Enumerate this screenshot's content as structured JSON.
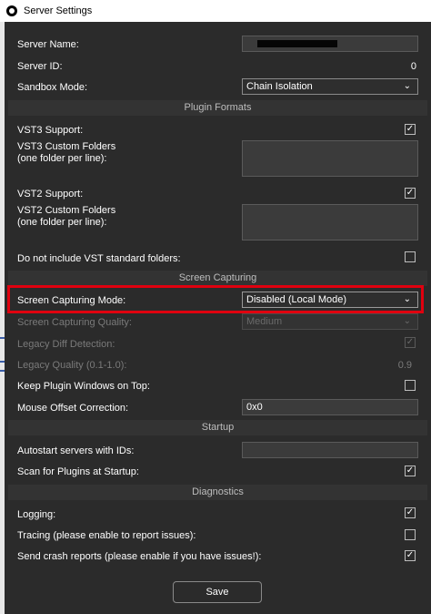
{
  "window": {
    "title": "Server Settings"
  },
  "fields": {
    "server_name": {
      "label": "Server Name:",
      "value": ""
    },
    "server_id": {
      "label": "Server ID:",
      "value": "0"
    },
    "sandbox_mode": {
      "label": "Sandbox Mode:",
      "value": "Chain Isolation"
    },
    "vst3_support": {
      "label": "VST3 Support:",
      "checked": true
    },
    "vst3_custom_folders": {
      "label_line1": "VST3 Custom Folders",
      "label_line2": "(one folder per line):",
      "value": ""
    },
    "vst2_support": {
      "label": "VST2 Support:",
      "checked": true
    },
    "vst2_custom_folders": {
      "label_line1": "VST2 Custom Folders",
      "label_line2": "(one folder per line):",
      "value": ""
    },
    "no_standard_folders": {
      "label": "Do not include VST standard folders:",
      "checked": false
    },
    "screen_capturing_mode": {
      "label": "Screen Capturing Mode:",
      "value": "Disabled (Local Mode)"
    },
    "screen_capturing_quality": {
      "label": "Screen Capturing Quality:",
      "value": "Medium"
    },
    "legacy_diff_detection": {
      "label": "Legacy Diff Detection:",
      "checked": true
    },
    "legacy_quality": {
      "label": "Legacy Quality (0.1-1.0):",
      "value": "0.9"
    },
    "keep_plugin_windows_on_top": {
      "label": "Keep Plugin Windows on Top:",
      "checked": false
    },
    "mouse_offset_correction": {
      "label": "Mouse Offset Correction:",
      "value": "0x0"
    },
    "autostart_servers": {
      "label": "Autostart servers with IDs:",
      "value": ""
    },
    "scan_plugins_at_startup": {
      "label": "Scan for Plugins at Startup:",
      "checked": true
    },
    "logging": {
      "label": "Logging:",
      "checked": true
    },
    "tracing": {
      "label": "Tracing (please enable to report issues):",
      "checked": false
    },
    "send_crash_reports": {
      "label": "Send crash reports (please enable if you have issues!):",
      "checked": true
    }
  },
  "sections": {
    "plugin_formats": "Plugin Formats",
    "screen_capturing": "Screen Capturing",
    "startup": "Startup",
    "diagnostics": "Diagnostics"
  },
  "buttons": {
    "save": "Save"
  },
  "colors": {
    "highlight": "#e0000f",
    "background": "#2b2b2b"
  },
  "icons": {
    "checkmark": "✓",
    "chevron": "⌄"
  }
}
